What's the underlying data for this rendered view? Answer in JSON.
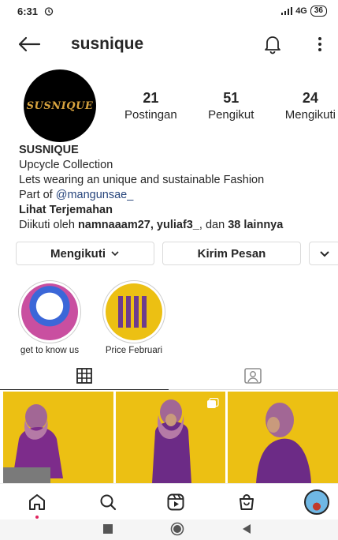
{
  "status_bar": {
    "time": "6:31",
    "network": "4G",
    "battery": "36"
  },
  "header": {
    "username": "susnique"
  },
  "profile": {
    "avatar_text": "SUSNIQUE",
    "stats": [
      {
        "value": "21",
        "label": "Postingan"
      },
      {
        "value": "51",
        "label": "Pengikut"
      },
      {
        "value": "24",
        "label": "Mengikuti"
      }
    ],
    "name": "SUSNIQUE",
    "bio_line1": "Upcycle Collection",
    "bio_line2": "Lets wearing an unique and sustainable Fashion",
    "bio_part_of": "Part of ",
    "bio_part_of_handle": "@mangunsae_",
    "translate": "Lihat Terjemahan",
    "followed_by_prefix": "Diikuti oleh ",
    "followed_by_names": "namnaaam27, yuliaf3_",
    "followed_by_mid": ", dan ",
    "followed_by_more": "38 lainnya"
  },
  "buttons": {
    "following": "Mengikuti",
    "message": "Kirim Pesan"
  },
  "highlights": [
    {
      "label": "get to know us"
    },
    {
      "label": "Price Februari"
    }
  ],
  "colors": {
    "post_background": "#ecc013",
    "link": "#27457c",
    "accent_dot": "#e0245e"
  }
}
